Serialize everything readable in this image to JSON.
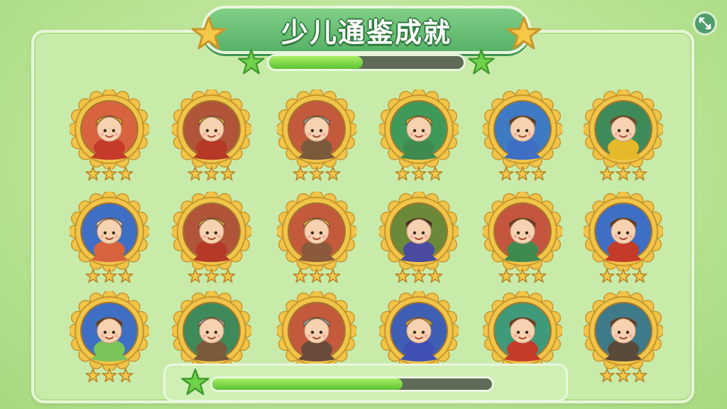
{
  "title": "少儿通鉴成就",
  "progress": {
    "top_fraction": 0.48,
    "bottom_fraction": 0.68
  },
  "colors": {
    "accent": "#5cc232",
    "gold": "#f1c232",
    "banner": "#57b267"
  },
  "corner_button": {
    "icon": "collapse-arrows-icon"
  },
  "achievements": [
    {
      "name": "emperor-yellow-crown",
      "bg": "#d8643f",
      "hat": "#e8b52a",
      "robe": "#c43b2a",
      "stars": 3
    },
    {
      "name": "warrior-spear-gold-helmet",
      "bg": "#b0543a",
      "hat": "#d4a535",
      "robe": "#b63826",
      "stars": 3
    },
    {
      "name": "knight-gray-helmet-red-plume",
      "bg": "#c45a3c",
      "hat": "#9aa3a8",
      "robe": "#7a5a3a",
      "stars": 3
    },
    {
      "name": "general-green-feather-helmet",
      "bg": "#3f9a5a",
      "hat": "#e2b23b",
      "robe": "#3f8a4f",
      "stars": 3
    },
    {
      "name": "boy-blue-shirt-waving",
      "bg": "#3f7ac4",
      "hat": "#5a3b26",
      "robe": "#3f6fc4",
      "stars": 3
    },
    {
      "name": "horned-hat-yellow-scarf",
      "bg": "#3f8a5a",
      "hat": "#7a4a2a",
      "robe": "#e6b92a",
      "stars": 3
    },
    {
      "name": "gray-haired-grandma",
      "bg": "#3f6fc4",
      "hat": "#d8d8d8",
      "robe": "#d8643f",
      "stars": 3
    },
    {
      "name": "warrior-sword-gold-helmet",
      "bg": "#b0543a",
      "hat": "#d4a535",
      "robe": "#b63826",
      "stars": 3
    },
    {
      "name": "bearded-king-gold-crown",
      "bg": "#c45a3c",
      "hat": "#e2b23b",
      "robe": "#8a5a3a",
      "stars": 3
    },
    {
      "name": "scholar-black-hat",
      "bg": "#6a8a3a",
      "hat": "#3a2a2a",
      "robe": "#4a4aa0",
      "stars": 3
    },
    {
      "name": "girl-braids-green-collar",
      "bg": "#c4563f",
      "hat": "#6a3a26",
      "robe": "#3f8a4f",
      "stars": 3
    },
    {
      "name": "boy-red-scarf-blue",
      "bg": "#3f6fc4",
      "hat": "#5a3b26",
      "robe": "#c43b2a",
      "stars": 3
    },
    {
      "name": "child-small-horns",
      "bg": "#3f6fc4",
      "hat": "#5a3b26",
      "robe": "#7ac45a",
      "stars": 3
    },
    {
      "name": "sage-scroll-gray-cap",
      "bg": "#3f8a5a",
      "hat": "#9aa3a8",
      "robe": "#7a5a3a",
      "stars": 3
    },
    {
      "name": "soldier-gray-helmet-plume",
      "bg": "#c45a3c",
      "hat": "#9aa3a8",
      "robe": "#6a4a3a",
      "stars": 3
    },
    {
      "name": "elder-king-white-beard",
      "bg": "#3f5fb4",
      "hat": "#e2b23b",
      "robe": "#3f4fb4",
      "stars": 3
    },
    {
      "name": "boy-red-cape",
      "bg": "#3f9a7a",
      "hat": "#6a3a26",
      "robe": "#c43b2a",
      "stars": 3
    },
    {
      "name": "horned-warrior-bearded",
      "bg": "#3f7a8a",
      "hat": "#5a3b26",
      "robe": "#5a4a3a",
      "stars": 3
    }
  ]
}
